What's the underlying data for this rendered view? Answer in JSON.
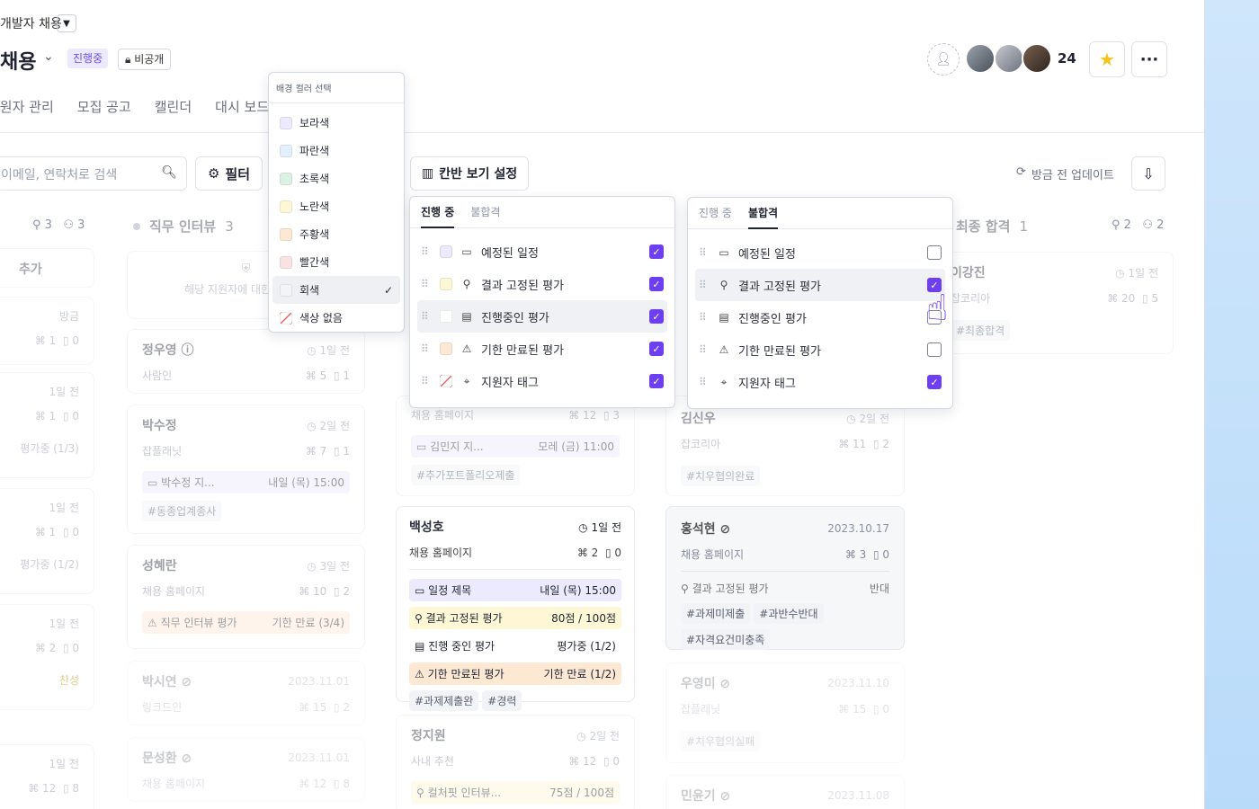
{
  "header": {
    "project_name": "개발자 채용",
    "title": "채용",
    "status_badge": "진행중",
    "visibility": "비공개",
    "member_count": "24"
  },
  "tabs": [
    "지원자 관리",
    "모집 공고",
    "캘린더",
    "대시 보드"
  ],
  "toolbar": {
    "search_placeholder": "이메일, 연락처로 검색",
    "filter_label": "필터",
    "kanban_label": "칸반 보기 설정",
    "update_label": "방금 전 업데이트"
  },
  "color_picker": {
    "title": "배경 컬러 선택",
    "options": [
      {
        "label": "보라색",
        "color": "#eceafd"
      },
      {
        "label": "파란색",
        "color": "#e3effd"
      },
      {
        "label": "초록색",
        "color": "#dcf1e4"
      },
      {
        "label": "노란색",
        "color": "#fdf7d6"
      },
      {
        "label": "주황색",
        "color": "#fde8d3"
      },
      {
        "label": "빨간색",
        "color": "#fbe2e2"
      },
      {
        "label": "회색",
        "color": "#f3f4f6"
      },
      {
        "label": "색상 없음",
        "color": "none"
      }
    ],
    "selected": "회색"
  },
  "kanban_settings_left": {
    "tabs": [
      "진행 중",
      "불합격"
    ],
    "active_tab": "진행 중",
    "items": [
      {
        "label": "예정된 일정",
        "checked": true
      },
      {
        "label": "결과 고정된 평가",
        "checked": true
      },
      {
        "label": "진행중인 평가",
        "checked": true
      },
      {
        "label": "기한 만료된 평가",
        "checked": true
      },
      {
        "label": "지원자 태그",
        "checked": true
      }
    ]
  },
  "kanban_settings_right": {
    "tabs": [
      "진행 중",
      "불합격"
    ],
    "active_tab": "불합격",
    "items": [
      {
        "label": "예정된 일정",
        "checked": false
      },
      {
        "label": "결과 고정된 평가",
        "checked": true
      },
      {
        "label": "진행중인 평가",
        "checked": false
      },
      {
        "label": "기한 만료된 평가",
        "checked": false
      },
      {
        "label": "지원자 태그",
        "checked": true
      }
    ]
  },
  "columns": {
    "col1": {
      "add_label": "추가",
      "stat_a": "3",
      "stat_b": "3"
    },
    "col2": {
      "title": "직무 인터뷰",
      "count": "3",
      "empty_text": "해당 지원자에 대한 열람 권"
    },
    "col5": {
      "title": "최종 합격",
      "count": "1",
      "stat_a": "2",
      "stat_b": "2"
    }
  },
  "col1_cards": [
    {
      "time": "방금",
      "a": "1",
      "b": "0"
    },
    {
      "time": "1일 전",
      "a": "1",
      "b": "0",
      "extra": "평가중 (1/3)"
    },
    {
      "time": "1일 전",
      "a": "1",
      "b": "0",
      "extra": "평가중 (1/2)"
    },
    {
      "time": "1일 전",
      "a": "2",
      "b": "0",
      "extra": "찬성"
    },
    {
      "time": "1일 전",
      "a": "12",
      "b": "8"
    }
  ],
  "col2_cards": [
    {
      "name": "정우영",
      "time": "1일 전",
      "source": "사람인",
      "a": "5",
      "b": "1"
    },
    {
      "name": "박수정",
      "time": "2일 전",
      "source": "잡플래닛",
      "a": "7",
      "b": "1",
      "event": "박수정 지...",
      "event_time": "내일 (목) 15:00",
      "tag": "#동종업계종사"
    },
    {
      "name": "성혜란",
      "time": "3일 전",
      "source": "채용 홈페이지",
      "a": "10",
      "b": "2",
      "eval": "직무 인터뷰 평가",
      "eval_status": "기한 만료 (3/4)"
    },
    {
      "name": "박시연",
      "time": "2023.11.01",
      "source": "링크드인",
      "a": "15",
      "b": "2"
    },
    {
      "name": "문성환",
      "time": "2023.11.01",
      "source": "채용 홈페이지",
      "a": "12",
      "b": "8"
    }
  ],
  "col3_cards": [
    {
      "source": "채용 홈페이지",
      "a": "12",
      "b": "3",
      "event": "김민지 지...",
      "event_time": "모레 (금) 11:00",
      "tag": "#추가포트폴리오제출"
    },
    {
      "name": "백성호",
      "time": "1일 전",
      "source": "채용 홈페이지",
      "a": "2",
      "b": "0",
      "rows": [
        {
          "label": "일정 제목",
          "value": "내일 (목) 15:00",
          "bg": "#eceafd"
        },
        {
          "label": "결과 고정된 평가",
          "value": "80점 / 100점",
          "bg": "#fdf7d6"
        },
        {
          "label": "진행 중인 평가",
          "value": "평가중 (1/2)",
          "bg": "#ffffff"
        },
        {
          "label": "기한 만료된 평가",
          "value": "기한 만료 (1/2)",
          "bg": "#fde8d3"
        }
      ],
      "tags": [
        "#과제제출완",
        "#경력"
      ]
    },
    {
      "name": "정지원",
      "time": "2일 전",
      "source": "사내 추천",
      "a": "12",
      "b": "0",
      "eval": "컬처핏 인터뷰...",
      "eval_status": "75점 / 100점"
    }
  ],
  "col4_cards": [
    {
      "name": "김신우",
      "time": "2일 전",
      "source": "잡코리아",
      "a": "11",
      "b": "2",
      "tag": "#치우협의완료"
    },
    {
      "name": "홍석현",
      "time": "2023.10.17",
      "source": "채용 홈페이지",
      "a": "3",
      "b": "0",
      "eval": "결과 고정된 평가",
      "eval_status": "반대",
      "tags": [
        "#과제미제출",
        "#과반수반대",
        "#자격요건미충족"
      ]
    },
    {
      "name": "우영미",
      "time": "2023.11.10",
      "source": "잡플래닛",
      "a": "15",
      "b": "0",
      "tag": "#치우협의실패"
    },
    {
      "name": "민윤기",
      "time": "2023.11.08"
    }
  ],
  "col5_cards": [
    {
      "name": "이강진",
      "time": "1일 전",
      "source": "잡코리아",
      "a": "20",
      "b": "5",
      "tag": "#최종합격"
    }
  ],
  "colors": {
    "accent": "#6d3ff0",
    "badge_bg": "#ece9fe",
    "star": "#f5c31b",
    "side_panel": "#cfe6fb"
  }
}
